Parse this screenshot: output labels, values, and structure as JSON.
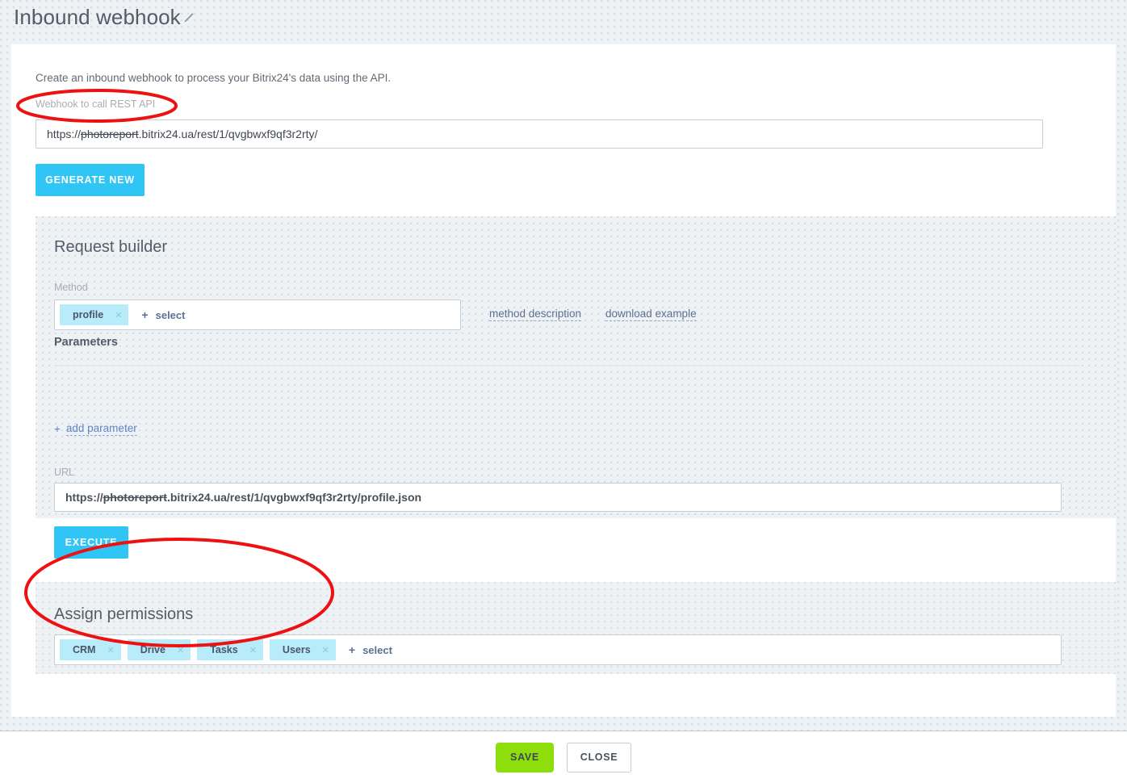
{
  "header": {
    "title": "Inbound webhook",
    "edit_icon": "pencil-icon"
  },
  "card": {
    "intro_text": "Create an inbound webhook to process your Bitrix24's data using the API.",
    "webhook_field": {
      "label": "Webhook to call REST API",
      "value_prefix": "https://",
      "value_struck": "photoreport",
      "value_suffix": ".bitrix24.ua/rest/1/qvgbwxf9qf3r2rty/",
      "full_value": "https://photoreport.bitrix24.ua/rest/1/qvgbwxf9qf3r2rty/"
    },
    "generate_new_label": "GENERATE NEW"
  },
  "request_builder": {
    "title": "Request builder",
    "method_label": "Method",
    "method_tags": [
      {
        "label": "profile",
        "remove_icon": "close-icon"
      }
    ],
    "method_select_label": "select",
    "method_select_plus": "+",
    "links": [
      {
        "label": "method description"
      },
      {
        "label": "download example"
      }
    ],
    "parameters_title": "Parameters",
    "add_parameter_plus": "+",
    "add_parameter_label": "add parameter",
    "url_label": "URL",
    "url_value": {
      "prefix": "https://",
      "struck": "photoreport",
      "suffix": ".bitrix24.ua/rest/1/qvgbwxf9qf3r2rty/profile.json",
      "full_value": "https://photoreport.bitrix24.ua/rest/1/qvgbwxf9qf3r2rty/profile.json"
    },
    "execute_label": "EXECUTE"
  },
  "assign_permissions": {
    "title": "Assign permissions",
    "tags": [
      {
        "label": "CRM",
        "remove_icon": "close-icon"
      },
      {
        "label": "Drive",
        "remove_icon": "close-icon"
      },
      {
        "label": "Tasks",
        "remove_icon": "close-icon"
      },
      {
        "label": "Users",
        "remove_icon": "close-icon"
      }
    ],
    "select_plus": "+",
    "select_label": "select"
  },
  "footer": {
    "save_label": "SAVE",
    "close_label": "CLOSE"
  },
  "annotations": [
    {
      "name": "webhook-label-highlight",
      "shape": "ellipse"
    },
    {
      "name": "assign-permissions-highlight",
      "shape": "ellipse"
    }
  ],
  "colors": {
    "accent_blue": "#2fc6f6",
    "tag_blue": "#b9ecfb",
    "save_green": "#8ede0b",
    "annotation_red": "#ee1111",
    "page_bg": "#eef2f5",
    "text_dark": "#535c69"
  }
}
